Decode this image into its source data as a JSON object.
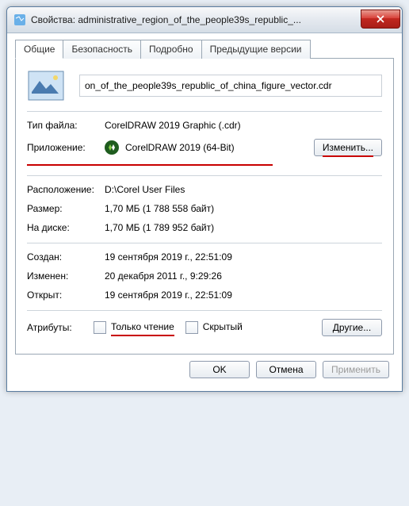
{
  "titlebar": {
    "prefix": "Свойства:",
    "file": "administrative_region_of_the_people39s_republic_..."
  },
  "tabs": [
    "Общие",
    "Безопасность",
    "Подробно",
    "Предыдущие версии"
  ],
  "filename_visible": "on_of_the_people39s_republic_of_china_figure_vector.cdr",
  "rows": {
    "filetype_label": "Тип файла:",
    "filetype_value": "CorelDRAW 2019 Graphic (.cdr)",
    "app_label": "Приложение:",
    "app_value": "CorelDRAW 2019 (64-Bit)",
    "change_btn": "Изменить...",
    "location_label": "Расположение:",
    "location_value": "D:\\Corel User Files",
    "size_label": "Размер:",
    "size_value": "1,70 МБ (1 788 558 байт)",
    "disk_label": "На диске:",
    "disk_value": "1,70 МБ (1 789 952 байт)",
    "created_label": "Создан:",
    "created_value": "19 сентября 2019 г., 22:51:09",
    "modified_label": "Изменен:",
    "modified_value": "20 декабря 2011 г., 9:29:26",
    "accessed_label": "Открыт:",
    "accessed_value": "19 сентября 2019 г., 22:51:09",
    "attrs_label": "Атрибуты:",
    "readonly": "Только чтение",
    "hidden": "Скрытый",
    "other_btn": "Другие..."
  },
  "footer": {
    "ok": "OK",
    "cancel": "Отмена",
    "apply": "Применить"
  }
}
